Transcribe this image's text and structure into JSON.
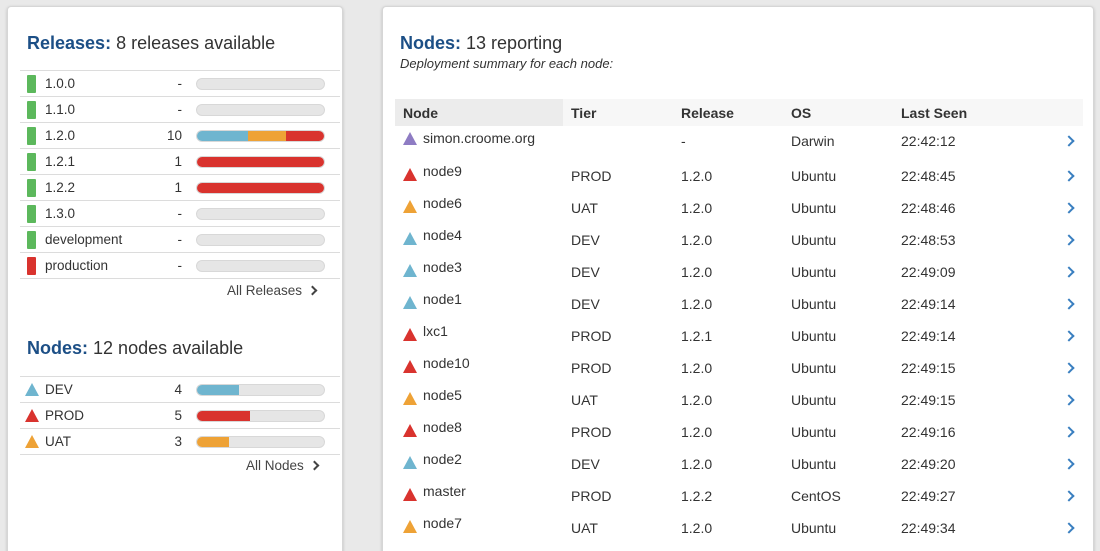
{
  "colors": {
    "green": "#5cb85c",
    "red": "#d9332e",
    "blue": "#6fb5cf",
    "orange": "#eea236",
    "purple": "#8e7cc3",
    "heading_blue": "#1c4f86",
    "chevron_blue": "#3a7fc0"
  },
  "releases": {
    "title_label": "Releases:",
    "title_text": "8 releases available",
    "items": [
      {
        "name": "1.0.0",
        "count": "-",
        "color": "green",
        "segments": []
      },
      {
        "name": "1.1.0",
        "count": "-",
        "color": "green",
        "segments": []
      },
      {
        "name": "1.2.0",
        "count": "10",
        "color": "green",
        "segments": [
          {
            "color": "blue",
            "fraction": 0.4
          },
          {
            "color": "orange",
            "fraction": 0.3
          },
          {
            "color": "red",
            "fraction": 0.3
          }
        ]
      },
      {
        "name": "1.2.1",
        "count": "1",
        "color": "green",
        "segments": [
          {
            "color": "red",
            "fraction": 1.0
          }
        ]
      },
      {
        "name": "1.2.2",
        "count": "1",
        "color": "green",
        "segments": [
          {
            "color": "red",
            "fraction": 1.0
          }
        ]
      },
      {
        "name": "1.3.0",
        "count": "-",
        "color": "green",
        "segments": []
      },
      {
        "name": "development",
        "count": "-",
        "color": "green",
        "segments": []
      },
      {
        "name": "production",
        "count": "-",
        "color": "red",
        "segments": []
      }
    ],
    "all_link": "All Releases"
  },
  "tiers": {
    "title_label": "Nodes:",
    "title_text": "12 nodes available",
    "items": [
      {
        "name": "DEV",
        "count": "4",
        "color": "blue",
        "fraction": 0.333
      },
      {
        "name": "PROD",
        "count": "5",
        "color": "red",
        "fraction": 0.417
      },
      {
        "name": "UAT",
        "count": "3",
        "color": "orange",
        "fraction": 0.25
      }
    ],
    "all_link": "All Nodes"
  },
  "nodes": {
    "title_label": "Nodes:",
    "title_text": "13 reporting",
    "subtitle": "Deployment summary for each node:",
    "columns": [
      "Node",
      "Tier",
      "Release",
      "OS",
      "Last Seen"
    ],
    "rows": [
      {
        "node": "simon.croome.org",
        "tier": "",
        "release": "-",
        "os": "Darwin",
        "last_seen": "22:42:12",
        "color": "purple"
      },
      {
        "node": "node9",
        "tier": "PROD",
        "release": "1.2.0",
        "os": "Ubuntu",
        "last_seen": "22:48:45",
        "color": "red"
      },
      {
        "node": "node6",
        "tier": "UAT",
        "release": "1.2.0",
        "os": "Ubuntu",
        "last_seen": "22:48:46",
        "color": "orange"
      },
      {
        "node": "node4",
        "tier": "DEV",
        "release": "1.2.0",
        "os": "Ubuntu",
        "last_seen": "22:48:53",
        "color": "blue"
      },
      {
        "node": "node3",
        "tier": "DEV",
        "release": "1.2.0",
        "os": "Ubuntu",
        "last_seen": "22:49:09",
        "color": "blue"
      },
      {
        "node": "node1",
        "tier": "DEV",
        "release": "1.2.0",
        "os": "Ubuntu",
        "last_seen": "22:49:14",
        "color": "blue"
      },
      {
        "node": "lxc1",
        "tier": "PROD",
        "release": "1.2.1",
        "os": "Ubuntu",
        "last_seen": "22:49:14",
        "color": "red"
      },
      {
        "node": "node10",
        "tier": "PROD",
        "release": "1.2.0",
        "os": "Ubuntu",
        "last_seen": "22:49:15",
        "color": "red"
      },
      {
        "node": "node5",
        "tier": "UAT",
        "release": "1.2.0",
        "os": "Ubuntu",
        "last_seen": "22:49:15",
        "color": "orange"
      },
      {
        "node": "node8",
        "tier": "PROD",
        "release": "1.2.0",
        "os": "Ubuntu",
        "last_seen": "22:49:16",
        "color": "red"
      },
      {
        "node": "node2",
        "tier": "DEV",
        "release": "1.2.0",
        "os": "Ubuntu",
        "last_seen": "22:49:20",
        "color": "blue"
      },
      {
        "node": "master",
        "tier": "PROD",
        "release": "1.2.2",
        "os": "CentOS",
        "last_seen": "22:49:27",
        "color": "red"
      },
      {
        "node": "node7",
        "tier": "UAT",
        "release": "1.2.0",
        "os": "Ubuntu",
        "last_seen": "22:49:34",
        "color": "orange"
      }
    ]
  }
}
